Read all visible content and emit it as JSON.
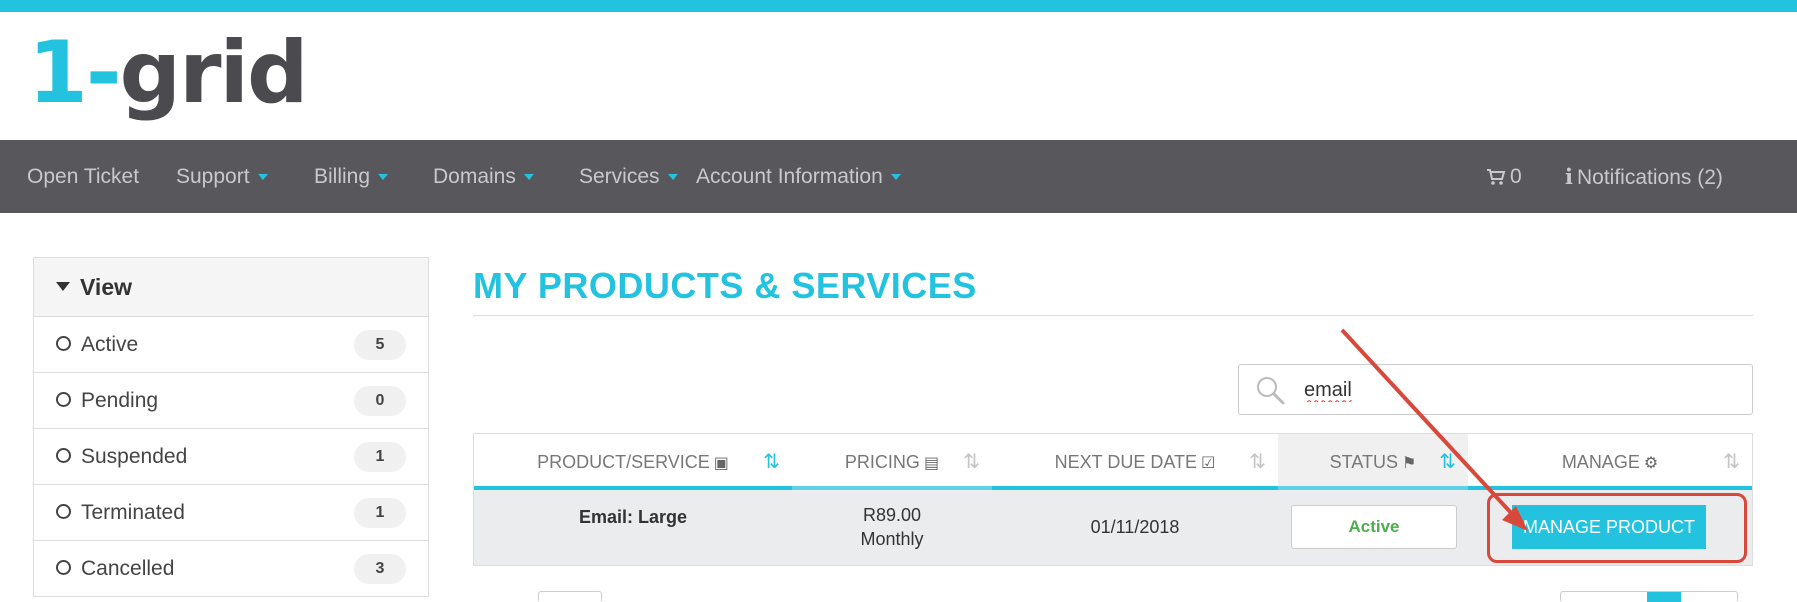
{
  "brand": {
    "logo_one": "1",
    "logo_dash": "-",
    "logo_rest": "grid",
    "accent_color": "#23c3df",
    "nav_bg_color": "#58585c"
  },
  "nav": {
    "items": [
      {
        "label": "Open Ticket",
        "dropdown": false
      },
      {
        "label": "Support",
        "dropdown": true
      },
      {
        "label": "Billing",
        "dropdown": true
      },
      {
        "label": "Domains",
        "dropdown": true
      },
      {
        "label": "Services",
        "dropdown": true
      },
      {
        "label": "Account Information",
        "dropdown": true
      }
    ],
    "cart": {
      "icon": "cart-icon",
      "count": "0"
    },
    "notifications": {
      "icon": "info-icon",
      "label": "Notifications (2)"
    }
  },
  "sidebar": {
    "title": "View",
    "title_icon": "filter-icon",
    "items": [
      {
        "label": "Active",
        "count": "5"
      },
      {
        "label": "Pending",
        "count": "0"
      },
      {
        "label": "Suspended",
        "count": "1"
      },
      {
        "label": "Terminated",
        "count": "1"
      },
      {
        "label": "Cancelled",
        "count": "3"
      }
    ]
  },
  "main": {
    "title": "MY PRODUCTS & SERVICES",
    "search": {
      "value": "email",
      "icon": "search-icon"
    },
    "table": {
      "columns": [
        {
          "label": "PRODUCT/SERVICE",
          "icon": "cube-icon"
        },
        {
          "label": "PRICING",
          "icon": "credit-card-icon"
        },
        {
          "label": "NEXT DUE DATE",
          "icon": "calendar-check-icon"
        },
        {
          "label": "STATUS",
          "icon": "flag-icon"
        },
        {
          "label": "MANAGE",
          "icon": "cogs-icon"
        }
      ],
      "rows": [
        {
          "product": "Email: Large",
          "price": "R89.00",
          "cycle": "Monthly",
          "due_date": "01/11/2018",
          "status": "Active",
          "action": "MANAGE PRODUCT"
        }
      ]
    }
  },
  "annotation": {
    "color": "#d9493b"
  }
}
